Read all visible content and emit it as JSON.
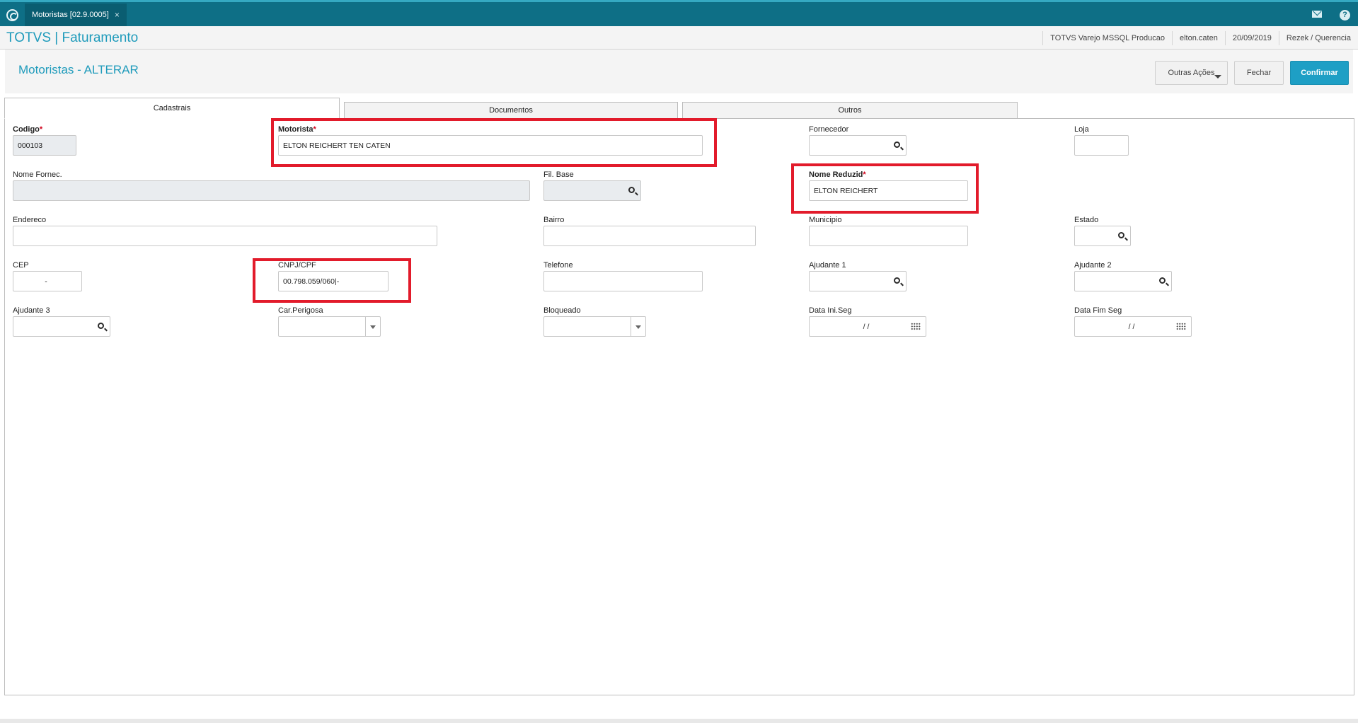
{
  "topbar": {
    "tab_label": "Motoristas [02.9.0005]",
    "tab_close": "×",
    "help_label": "?"
  },
  "header": {
    "brand": "TOTVS | Faturamento",
    "environment": "TOTVS Varejo MSSQL Producao",
    "user": "elton.caten",
    "date": "20/09/2019",
    "branch": "Rezek / Querencia"
  },
  "page": {
    "title": "Motoristas - ALTERAR",
    "buttons": {
      "outras": "Outras Ações",
      "fechar": "Fechar",
      "confirmar": "Confirmar"
    }
  },
  "tabs": [
    {
      "label": "Cadastrais",
      "active": true
    },
    {
      "label": "Documentos",
      "active": false
    },
    {
      "label": "Outros",
      "active": false
    }
  ],
  "form": {
    "codigo": {
      "label": "Codigo",
      "value": "000103"
    },
    "motorista": {
      "label": "Motorista",
      "value": "ELTON REICHERT TEN CATEN"
    },
    "fornecedor": {
      "label": "Fornecedor",
      "value": ""
    },
    "loja": {
      "label": "Loja",
      "value": ""
    },
    "nome_fornec": {
      "label": "Nome Fornec.",
      "value": ""
    },
    "fil_base": {
      "label": "Fil. Base",
      "value": ""
    },
    "nome_reduzid": {
      "label": "Nome Reduzid",
      "value": "ELTON REICHERT"
    },
    "endereco": {
      "label": "Endereco",
      "value": ""
    },
    "bairro": {
      "label": "Bairro",
      "value": ""
    },
    "municipio": {
      "label": "Municipio",
      "value": ""
    },
    "estado": {
      "label": "Estado",
      "value": ""
    },
    "cep": {
      "label": "CEP",
      "value": "-"
    },
    "cnpj_cpf": {
      "label": "CNPJ/CPF",
      "value": "00.798.059/060|-"
    },
    "telefone": {
      "label": "Telefone",
      "value": ""
    },
    "ajudante1": {
      "label": "Ajudante 1",
      "value": ""
    },
    "ajudante2": {
      "label": "Ajudante 2",
      "value": ""
    },
    "ajudante3": {
      "label": "Ajudante 3",
      "value": ""
    },
    "car_perigosa": {
      "label": "Car.Perigosa",
      "value": ""
    },
    "bloqueado": {
      "label": "Bloqueado",
      "value": ""
    },
    "data_ini_seg": {
      "label": "Data Ini.Seg",
      "value": "/ /"
    },
    "data_fim_seg": {
      "label": "Data Fim Seg",
      "value": "/ /"
    },
    "required_mark": "*"
  },
  "colors": {
    "topbar": "#0e6f86",
    "brand": "#1f9bbb",
    "confirm_button": "#1e9fc5",
    "highlight": "#e21b2b",
    "required": "#d0021b"
  }
}
